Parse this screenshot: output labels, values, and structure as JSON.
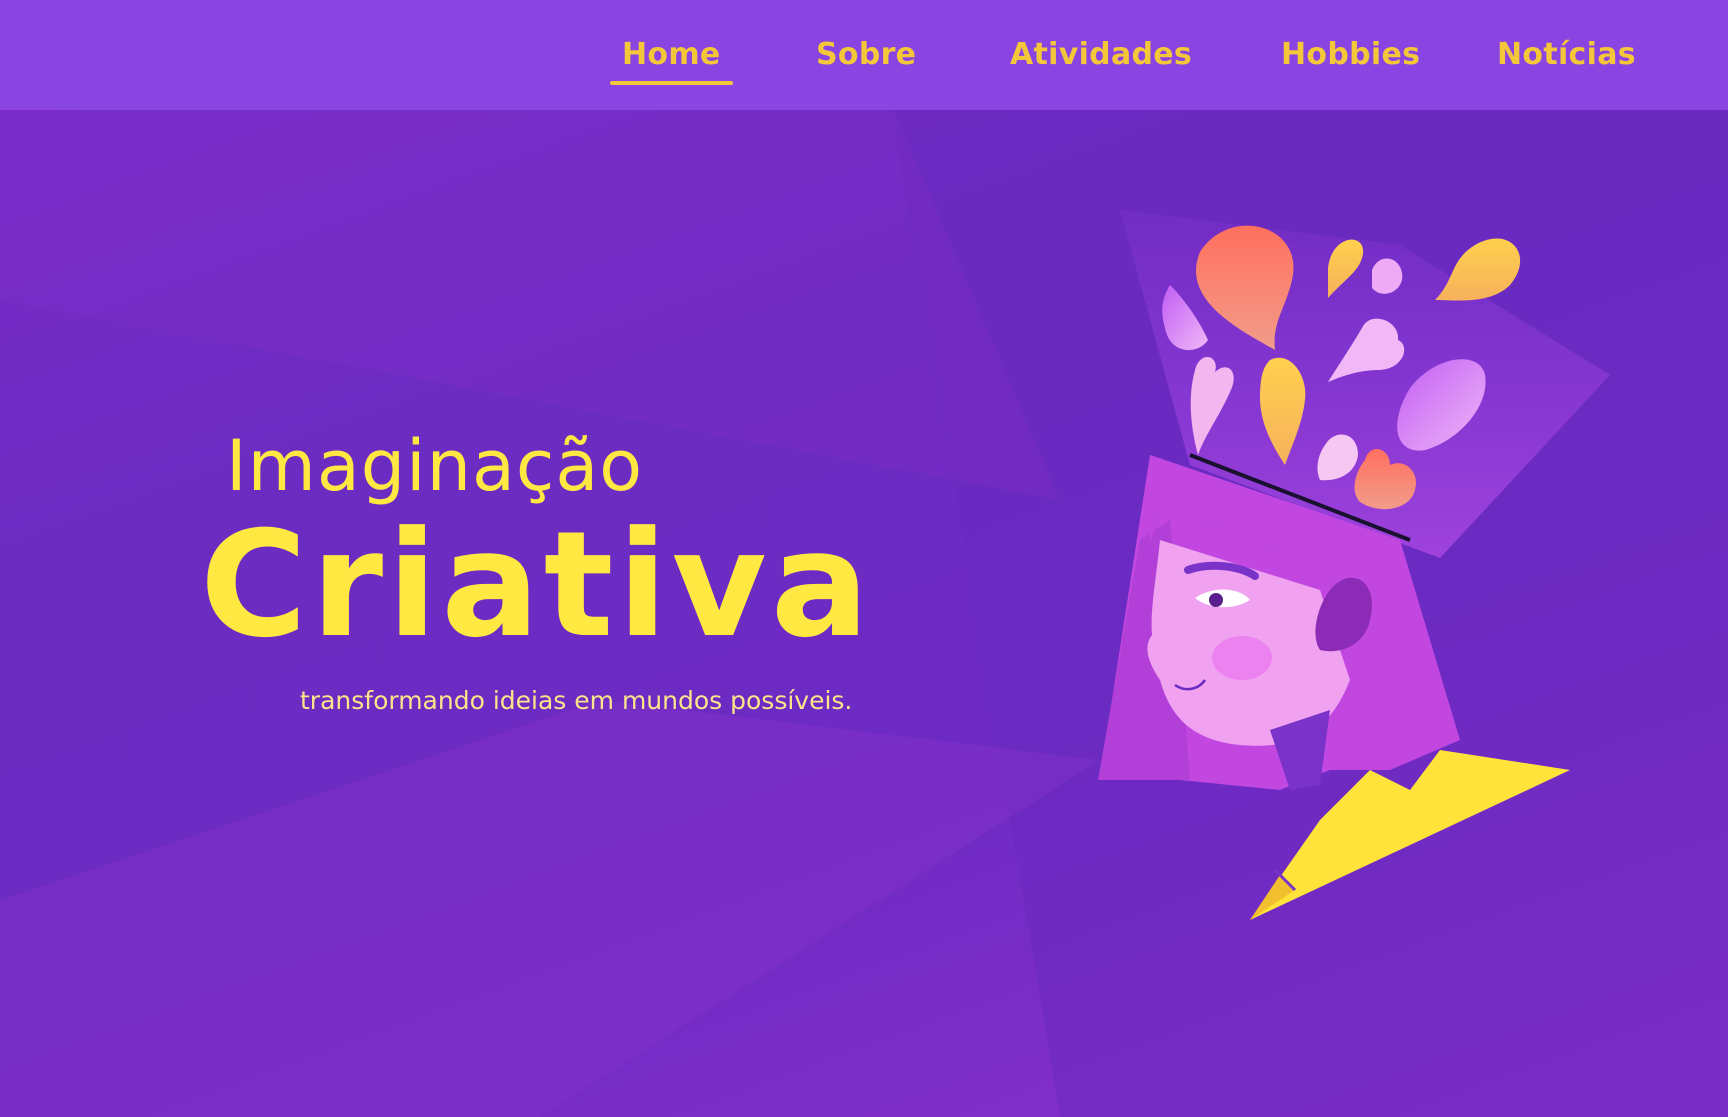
{
  "nav": {
    "items": [
      {
        "label": "Home",
        "active": true
      },
      {
        "label": "Sobre",
        "active": false
      },
      {
        "label": "Atividades",
        "active": false
      },
      {
        "label": "Hobbies",
        "active": false
      },
      {
        "label": "Notícias",
        "active": false
      }
    ]
  },
  "hero": {
    "title_small": "Imaginação",
    "title_big": "Criativa",
    "subtitle": "transformando ideias em mundos possíveis."
  },
  "colors": {
    "nav_background": "#8a44e2",
    "background": "#6e2ac4",
    "accent_yellow": "#ffe842",
    "nav_text": "#f4c63a"
  },
  "illustration": {
    "icon": "creative-head-illustration"
  }
}
